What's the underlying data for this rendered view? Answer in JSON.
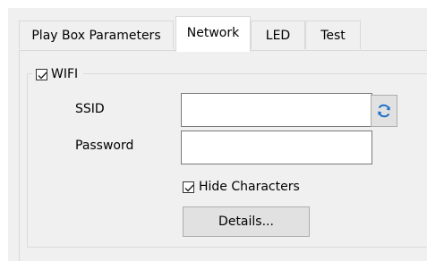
{
  "tabs": [
    {
      "label": "Play Box Parameters"
    },
    {
      "label": "Network",
      "active": true
    },
    {
      "label": "LED"
    },
    {
      "label": "Test"
    }
  ],
  "wifi_group": {
    "label": "WIFI",
    "checked": true,
    "ssid": {
      "label": "SSID",
      "value": "",
      "refresh_icon": "refresh-icon"
    },
    "password": {
      "label": "Password",
      "value": ""
    },
    "hide_characters": {
      "label": "Hide Characters",
      "checked": true
    },
    "details_button_label": "Details..."
  },
  "colors": {
    "dialog_background": "#f0f0f0",
    "refresh_icon": "#1a6fc9"
  }
}
